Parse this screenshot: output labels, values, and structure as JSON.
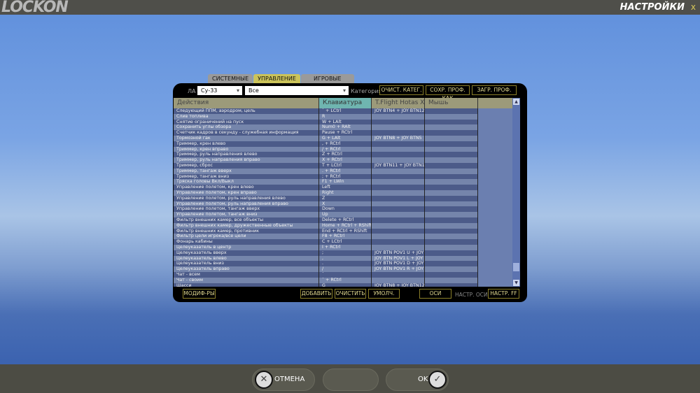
{
  "header": {
    "logo": "LOCKON",
    "title": "НАСТРОЙКИ",
    "close": "x"
  },
  "tabs": [
    "СИСТЕМНЫЕ",
    "УПРАВЛЕНИЕ",
    "ИГРОВЫЕ"
  ],
  "filters": {
    "aircraft_label": "ЛА",
    "aircraft": "Су-33",
    "category_value": "Все",
    "category_label": "Категория"
  },
  "top_buttons": [
    "ОЧИСТ. КАТЕГ.",
    "СОХР. ПРОФ. КАК",
    "ЗАГР. ПРОФ."
  ],
  "columns": [
    "Действия",
    "Клавиатура",
    "T.Flight Hotas X {D",
    "Мышь"
  ],
  "rows": [
    [
      "Следующий ППМ, аэродром, цель",
      "` + LCtrl",
      "JOY BTN4 + JOY BTN12",
      ""
    ],
    [
      "Слив топлива",
      "R",
      "",
      ""
    ],
    [
      "Снятие ограничений на пуск",
      "W + LAlt",
      "",
      ""
    ],
    [
      "Сохранить углы обзора",
      "Num0 + RAlt",
      "",
      ""
    ],
    [
      "Счетчик кадров в секунду - служебная информация",
      "Pause + RCtrl",
      "",
      ""
    ],
    [
      "Тормозной гак",
      "G + LAlt",
      "JOY BTN8 + JOY BTN5",
      ""
    ],
    [
      "Триммер, крен влево",
      ", + RCtrl",
      "",
      ""
    ],
    [
      "Триммер, крен вправо",
      "/ + RCtrl",
      "",
      ""
    ],
    [
      "Триммер, руль направления влево",
      "Z + RCtrl",
      "",
      ""
    ],
    [
      "Триммер, руль направления вправо",
      "X + RCtrl",
      "",
      ""
    ],
    [
      "Триммер, сброс",
      "T + LCtrl",
      "JOY BTN11 + JOY BTN12",
      ""
    ],
    [
      "Триммер, тангаж вверх",
      ". + RCtrl",
      "",
      ""
    ],
    [
      "Триммер, тангаж вниз",
      "; + RCtrl",
      "",
      ""
    ],
    [
      "Тряска головы Вкл/Выкл",
      "F1 + LWin",
      "",
      ""
    ],
    [
      "Управление полетом, крен влево",
      "Left",
      "",
      ""
    ],
    [
      "Управление полетом, крен вправо",
      "Right",
      "",
      ""
    ],
    [
      "Управление полетом, руль направления влево",
      "Z",
      "",
      ""
    ],
    [
      "Управление полетом, руль направления вправо",
      "X",
      "",
      ""
    ],
    [
      "Управление полетом, тангаж вверх",
      "Down",
      "",
      ""
    ],
    [
      "Управление полетом, тангаж вниз",
      "Up",
      "",
      ""
    ],
    [
      "Фильтр внешних камер, все объекты",
      "Delete + RCtrl",
      "",
      ""
    ],
    [
      "Фильтр внешних камер, дружественные объекты",
      "Home + RCtrl + RShift",
      "",
      ""
    ],
    [
      "Фильтр внешних камер, противник",
      "End + RCtrl + RShift",
      "",
      ""
    ],
    [
      "Фильтр цели игрока/все цели",
      "F8 + RCtrl",
      "",
      ""
    ],
    [
      "Фонарь кабины",
      "C + LCtrl",
      "",
      ""
    ],
    [
      "Целеуказатель в центр",
      "I + RCtrl",
      "",
      ""
    ],
    [
      "Целеуказатель вверх",
      ";",
      "JOY BTN POV1 U + JOY B",
      ""
    ],
    [
      "Целеуказатель влево",
      ",",
      "JOY BTN POV1 L + JOY B",
      ""
    ],
    [
      "Целеуказатель вниз",
      ".",
      "JOY BTN POV1 D + JOY B",
      ""
    ],
    [
      "Целеуказатель вправо",
      "/",
      "JOY BTN POV1 R + JOY B",
      ""
    ],
    [
      "Чат - всем",
      "`",
      "",
      ""
    ],
    [
      "Чат - своим",
      "` + RCtrl",
      "",
      ""
    ],
    [
      "Шасси",
      "G",
      "JOY BTN8 + JOY BTN12",
      ""
    ]
  ],
  "bottom_buttons": {
    "modifiers": "МОДИФ-РЫ",
    "add": "ДОБАВИТЬ",
    "clear": "ОЧИСТИТЬ",
    "default": "УМОЛЧ.",
    "axes": "ОСИ",
    "axis_tune": "НАСТР. ОСИ",
    "ff_tune": "НАСТР. FF"
  },
  "footer": {
    "cancel": "ОТМЕНА",
    "ok": "OK"
  }
}
